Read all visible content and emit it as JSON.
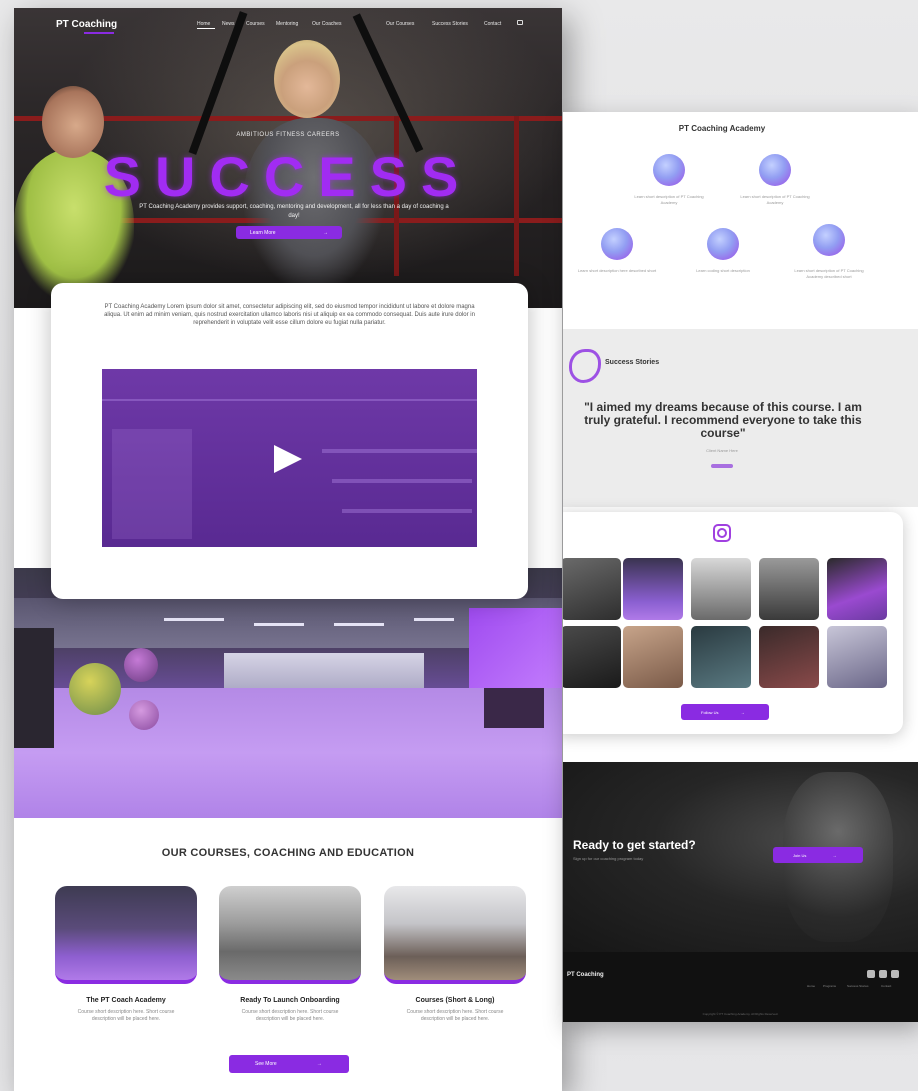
{
  "left_page": {
    "nav": {
      "logo": "PT Coaching",
      "items": [
        "Home",
        "News",
        "Courses",
        "Mentoring",
        "Our Coaches",
        "Our Courses",
        "Success Stories",
        "Contact"
      ]
    },
    "hero": {
      "kicker": "AMBITIOUS FITNESS CAREERS",
      "title": "SUCCESS",
      "subtitle": "PT Coaching Academy provides support, coaching, mentoring and development, all for less than a day of coaching a day!",
      "button_label": "Learn More",
      "button_arrow": "→"
    },
    "about": {
      "text": "PT Coaching Academy Lorem ipsum dolor sit amet, consectetur adipiscing elit, sed do eiusmod tempor incididunt ut labore et dolore magna aliqua. Ut enim ad minim veniam, quis nostrud exercitation ullamco laboris nisi ut aliquip ex ea commodo consequat. Duis aute irure dolor in reprehenderit in voluptate velit esse cillum dolore eu fugiat nulla pariatur.",
      "video_icon": "play-icon"
    },
    "courses": {
      "heading": "OUR COURSES, COACHING AND EDUCATION",
      "items": [
        {
          "title": "The PT Coach Academy",
          "desc": "Course short description here. Short course description will be placed here."
        },
        {
          "title": "Ready To Launch Onboarding",
          "desc": "Course short description here. Short course description will be placed here."
        },
        {
          "title": "Courses (Short & Long)",
          "desc": "Course short description here. Short course description will be placed here."
        }
      ],
      "see_more_label": "See More",
      "see_more_arrow": "→"
    }
  },
  "right_page": {
    "academy": {
      "title": "PT Coaching Academy",
      "features": [
        {
          "icon": "growth-icon",
          "text": "Learn short description of PT Coaching Academy"
        },
        {
          "icon": "headset-icon",
          "text": "Learn short description of PT Coaching Academy"
        },
        {
          "icon": "team-icon",
          "text": "Learn short description here described short"
        },
        {
          "icon": "network-icon",
          "text": "Learn coding short description"
        },
        {
          "icon": "coach-icon",
          "text": "Learn short description of PT Coaching Academy described short"
        }
      ]
    },
    "stories": {
      "heading": "Success Stories",
      "quote": "\"I aimed my dreams because of this course. I am truly grateful. I recommend everyone to take this course\"",
      "author": "Client Name Here"
    },
    "instagram": {
      "icon": "instagram-icon",
      "follow_label": "Follow Us",
      "follow_arrow": "→"
    },
    "cta": {
      "heading": "Ready to get started?",
      "sub": "Sign up for our coaching program today",
      "button_label": "Join Us",
      "button_arrow": "→"
    },
    "footer": {
      "logo": "PT Coaching",
      "links": [
        "Home",
        "Programs",
        "Success Stories",
        "Contact"
      ],
      "copyright": "Copyright © PT Coaching Academy. All Rights Reserved."
    }
  },
  "colors": {
    "accent": "#8a2be2",
    "hero_title": "#a12cf2",
    "dark": "#161616"
  }
}
